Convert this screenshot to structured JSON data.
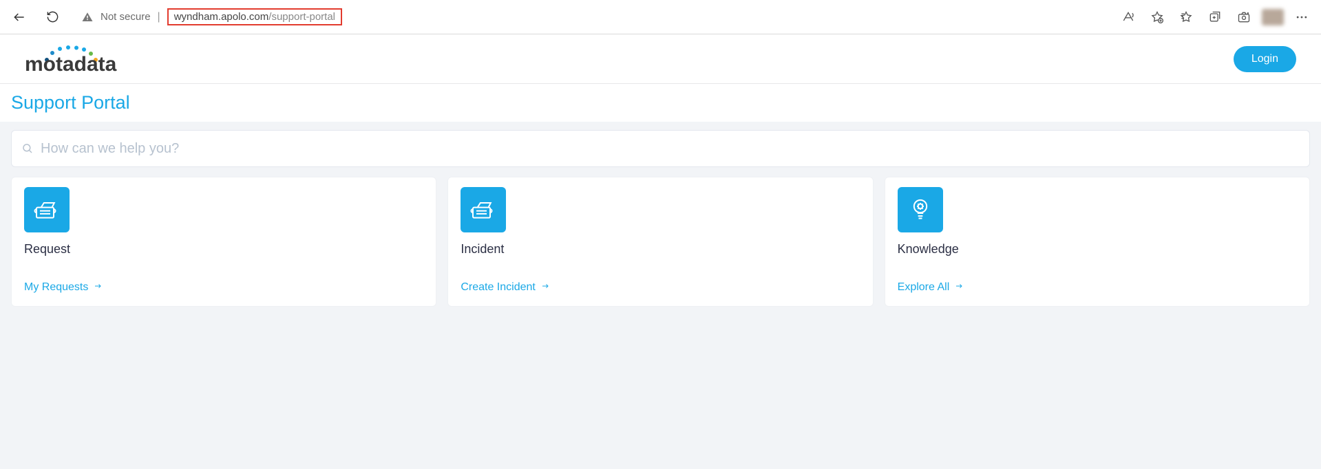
{
  "browser": {
    "not_secure": "Not secure",
    "url_main": "wyndham.apolo.com",
    "url_path": "/support-portal"
  },
  "header": {
    "logo_text": "motadata",
    "login": "Login"
  },
  "page": {
    "title": "Support Portal"
  },
  "search": {
    "placeholder": "How can we help you?"
  },
  "cards": [
    {
      "title": "Request",
      "link": "My Requests"
    },
    {
      "title": "Incident",
      "link": "Create Incident"
    },
    {
      "title": "Knowledge",
      "link": "Explore All"
    }
  ]
}
